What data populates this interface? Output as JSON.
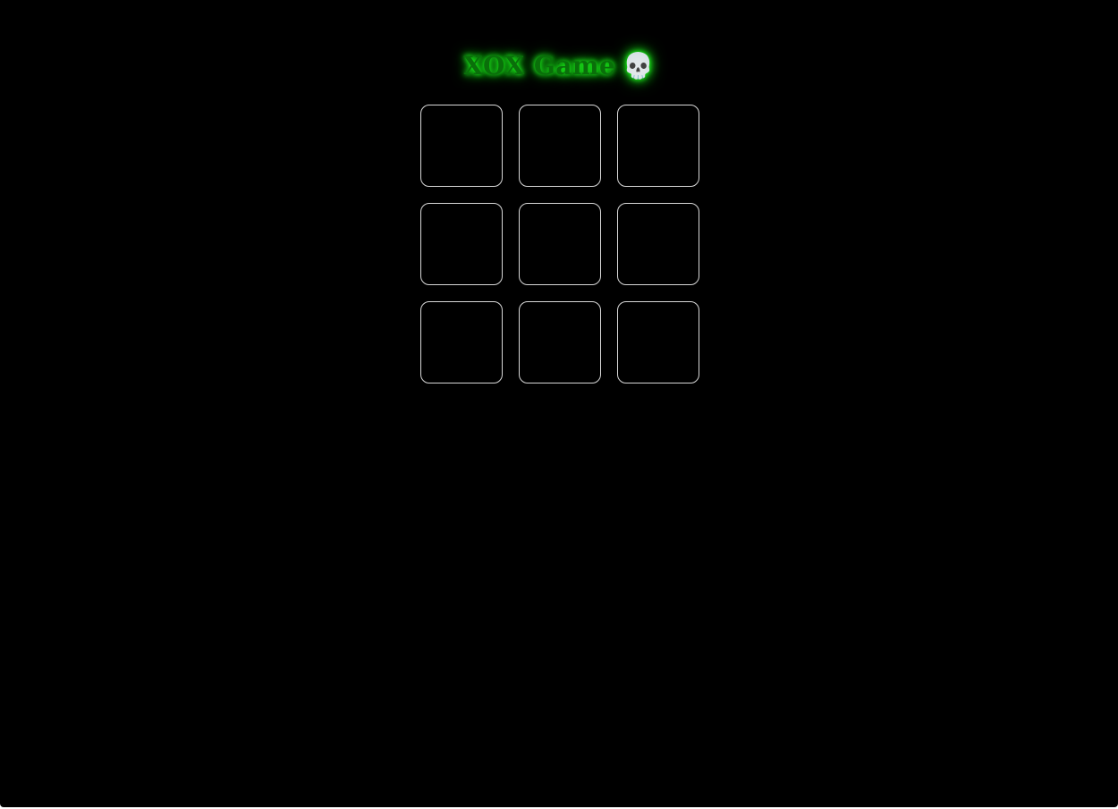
{
  "game": {
    "title": "XOX Game",
    "title_emoji": "💀",
    "board": [
      "",
      "",
      "",
      "",
      "",
      "",
      "",
      "",
      ""
    ]
  },
  "colors": {
    "background": "#000000",
    "title_glow": "#1bff1b",
    "title_text": "#0a6f0a",
    "cell_border": "#d8d8d8"
  },
  "icons": {
    "title_icon": "skull-icon"
  }
}
